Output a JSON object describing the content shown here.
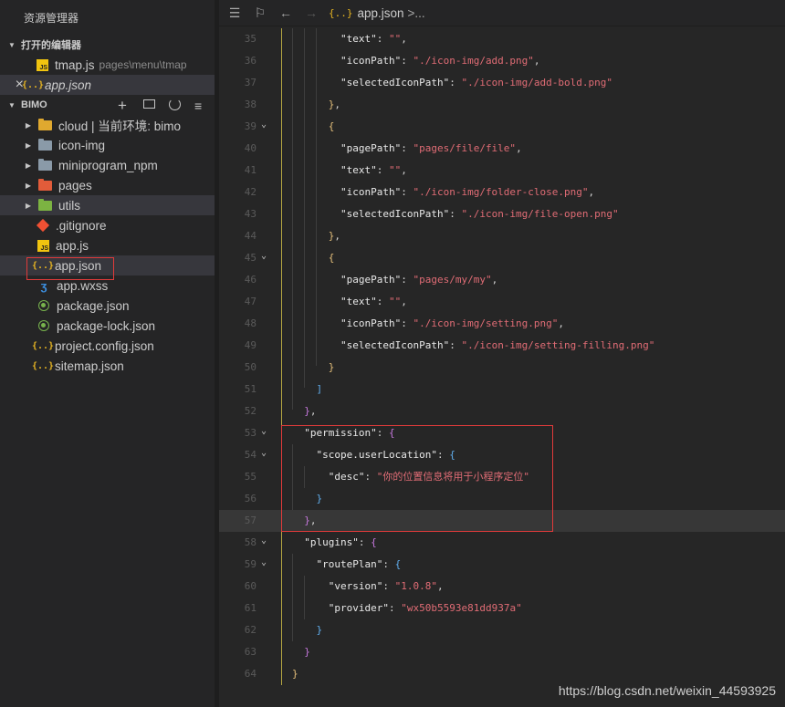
{
  "sidebar": {
    "title": "资源管理器",
    "open_editors": {
      "label": "打开的编辑器",
      "items": [
        {
          "name": "tmap.js",
          "path": "pages\\menu\\tmap",
          "icon": "js-file-icon"
        },
        {
          "close": "×",
          "name": "app.json",
          "icon": "json-file-icon"
        }
      ]
    },
    "project": {
      "label": "BIMO",
      "toolbar_icons": [
        "new-file-icon",
        "new-folder-icon",
        "refresh-icon",
        "collapse-all-icon"
      ],
      "items": [
        {
          "name": "cloud | 当前环境: bimo",
          "type": "folder",
          "color": "#e0a92f"
        },
        {
          "name": "icon-img",
          "type": "folder",
          "color": "#8a9aa8"
        },
        {
          "name": "miniprogram_npm",
          "type": "folder",
          "color": "#8a9aa8"
        },
        {
          "name": "pages",
          "type": "folder",
          "color": "#e25c3a"
        },
        {
          "name": "utils",
          "type": "folder",
          "color": "#7cb342"
        },
        {
          "name": ".gitignore",
          "type": "git"
        },
        {
          "name": "app.js",
          "type": "js"
        },
        {
          "name": "app.json",
          "type": "json"
        },
        {
          "name": "app.wxss",
          "type": "wxss"
        },
        {
          "name": "package.json",
          "type": "npm"
        },
        {
          "name": "package-lock.json",
          "type": "npm"
        },
        {
          "name": "project.config.json",
          "type": "json"
        },
        {
          "name": "sitemap.json",
          "type": "json"
        }
      ]
    }
  },
  "editor": {
    "breadcrumb": {
      "file": "app.json",
      "more": ">..."
    },
    "lines": [
      {
        "n": "35",
        "parts": [
          [
            "        ",
            "pun"
          ],
          [
            "\"text\"",
            "key"
          ],
          [
            ": ",
            "pun"
          ],
          [
            "\"\"",
            "str"
          ],
          [
            ",",
            "pun"
          ]
        ]
      },
      {
        "n": "36",
        "parts": [
          [
            "        ",
            "pun"
          ],
          [
            "\"iconPath\"",
            "key"
          ],
          [
            ": ",
            "pun"
          ],
          [
            "\"./icon-img/add.png\"",
            "str"
          ],
          [
            ",",
            "pun"
          ]
        ]
      },
      {
        "n": "37",
        "parts": [
          [
            "        ",
            "pun"
          ],
          [
            "\"selectedIconPath\"",
            "key"
          ],
          [
            ": ",
            "pun"
          ],
          [
            "\"./icon-img/add-bold.png\"",
            "str"
          ]
        ]
      },
      {
        "n": "38",
        "parts": [
          [
            "      ",
            "pun"
          ],
          [
            "}",
            "b1"
          ],
          [
            ",",
            "pun"
          ]
        ]
      },
      {
        "n": "39",
        "fold": "⌄",
        "parts": [
          [
            "      ",
            "pun"
          ],
          [
            "{",
            "b1"
          ]
        ]
      },
      {
        "n": "40",
        "parts": [
          [
            "        ",
            "pun"
          ],
          [
            "\"pagePath\"",
            "key"
          ],
          [
            ": ",
            "pun"
          ],
          [
            "\"pages/file/file\"",
            "str"
          ],
          [
            ",",
            "pun"
          ]
        ]
      },
      {
        "n": "41",
        "parts": [
          [
            "        ",
            "pun"
          ],
          [
            "\"text\"",
            "key"
          ],
          [
            ": ",
            "pun"
          ],
          [
            "\"\"",
            "str"
          ],
          [
            ",",
            "pun"
          ]
        ]
      },
      {
        "n": "42",
        "parts": [
          [
            "        ",
            "pun"
          ],
          [
            "\"iconPath\"",
            "key"
          ],
          [
            ": ",
            "pun"
          ],
          [
            "\"./icon-img/folder-close.png\"",
            "str"
          ],
          [
            ",",
            "pun"
          ]
        ]
      },
      {
        "n": "43",
        "parts": [
          [
            "        ",
            "pun"
          ],
          [
            "\"selectedIconPath\"",
            "key"
          ],
          [
            ": ",
            "pun"
          ],
          [
            "\"./icon-img/file-open.png\"",
            "str"
          ]
        ]
      },
      {
        "n": "44",
        "parts": [
          [
            "      ",
            "pun"
          ],
          [
            "}",
            "b1"
          ],
          [
            ",",
            "pun"
          ]
        ]
      },
      {
        "n": "45",
        "fold": "⌄",
        "parts": [
          [
            "      ",
            "pun"
          ],
          [
            "{",
            "b1"
          ]
        ]
      },
      {
        "n": "46",
        "parts": [
          [
            "        ",
            "pun"
          ],
          [
            "\"pagePath\"",
            "key"
          ],
          [
            ": ",
            "pun"
          ],
          [
            "\"pages/my/my\"",
            "str"
          ],
          [
            ",",
            "pun"
          ]
        ]
      },
      {
        "n": "47",
        "parts": [
          [
            "        ",
            "pun"
          ],
          [
            "\"text\"",
            "key"
          ],
          [
            ": ",
            "pun"
          ],
          [
            "\"\"",
            "str"
          ],
          [
            ",",
            "pun"
          ]
        ]
      },
      {
        "n": "48",
        "parts": [
          [
            "        ",
            "pun"
          ],
          [
            "\"iconPath\"",
            "key"
          ],
          [
            ": ",
            "pun"
          ],
          [
            "\"./icon-img/setting.png\"",
            "str"
          ],
          [
            ",",
            "pun"
          ]
        ]
      },
      {
        "n": "49",
        "parts": [
          [
            "        ",
            "pun"
          ],
          [
            "\"selectedIconPath\"",
            "key"
          ],
          [
            ": ",
            "pun"
          ],
          [
            "\"./icon-img/setting-filling.png\"",
            "str"
          ]
        ]
      },
      {
        "n": "50",
        "parts": [
          [
            "      ",
            "pun"
          ],
          [
            "}",
            "b1"
          ]
        ]
      },
      {
        "n": "51",
        "parts": [
          [
            "    ",
            "pun"
          ],
          [
            "]",
            "b3"
          ]
        ]
      },
      {
        "n": "52",
        "parts": [
          [
            "  ",
            "pun"
          ],
          [
            "}",
            "b2"
          ],
          [
            ",",
            "pun"
          ]
        ]
      },
      {
        "n": "53",
        "fold": "⌄",
        "parts": [
          [
            "  ",
            "pun"
          ],
          [
            "\"permission\"",
            "key"
          ],
          [
            ": ",
            "pun"
          ],
          [
            "{",
            "b2"
          ]
        ]
      },
      {
        "n": "54",
        "fold": "⌄",
        "parts": [
          [
            "    ",
            "pun"
          ],
          [
            "\"scope.userLocation\"",
            "key"
          ],
          [
            ": ",
            "pun"
          ],
          [
            "{",
            "b3"
          ]
        ]
      },
      {
        "n": "55",
        "parts": [
          [
            "      ",
            "pun"
          ],
          [
            "\"desc\"",
            "key"
          ],
          [
            ": ",
            "pun"
          ],
          [
            "\"你的位置信息将用于小程序定位\"",
            "str"
          ]
        ]
      },
      {
        "n": "56",
        "parts": [
          [
            "    ",
            "pun"
          ],
          [
            "}",
            "b3"
          ]
        ]
      },
      {
        "n": "57",
        "cur": true,
        "parts": [
          [
            "  ",
            "pun"
          ],
          [
            "}",
            "b2"
          ],
          [
            ",",
            "pun"
          ]
        ]
      },
      {
        "n": "58",
        "fold": "⌄",
        "parts": [
          [
            "  ",
            "pun"
          ],
          [
            "\"plugins\"",
            "key"
          ],
          [
            ": ",
            "pun"
          ],
          [
            "{",
            "b2"
          ]
        ]
      },
      {
        "n": "59",
        "fold": "⌄",
        "parts": [
          [
            "    ",
            "pun"
          ],
          [
            "\"routePlan\"",
            "key"
          ],
          [
            ": ",
            "pun"
          ],
          [
            "{",
            "b3"
          ]
        ]
      },
      {
        "n": "60",
        "parts": [
          [
            "      ",
            "pun"
          ],
          [
            "\"version\"",
            "key"
          ],
          [
            ": ",
            "pun"
          ],
          [
            "\"1.0.8\"",
            "str"
          ],
          [
            ",",
            "pun"
          ]
        ]
      },
      {
        "n": "61",
        "parts": [
          [
            "      ",
            "pun"
          ],
          [
            "\"provider\"",
            "key"
          ],
          [
            ": ",
            "pun"
          ],
          [
            "\"wx50b5593e81dd937a\"",
            "str"
          ]
        ]
      },
      {
        "n": "62",
        "parts": [
          [
            "    ",
            "pun"
          ],
          [
            "}",
            "b3"
          ]
        ]
      },
      {
        "n": "63",
        "parts": [
          [
            "  ",
            "pun"
          ],
          [
            "}",
            "b2"
          ]
        ]
      },
      {
        "n": "64",
        "parts": [
          [
            "",
            "pun"
          ],
          [
            "}",
            "b1"
          ]
        ]
      }
    ]
  },
  "watermark": "https://blog.csdn.net/weixin_44593925"
}
